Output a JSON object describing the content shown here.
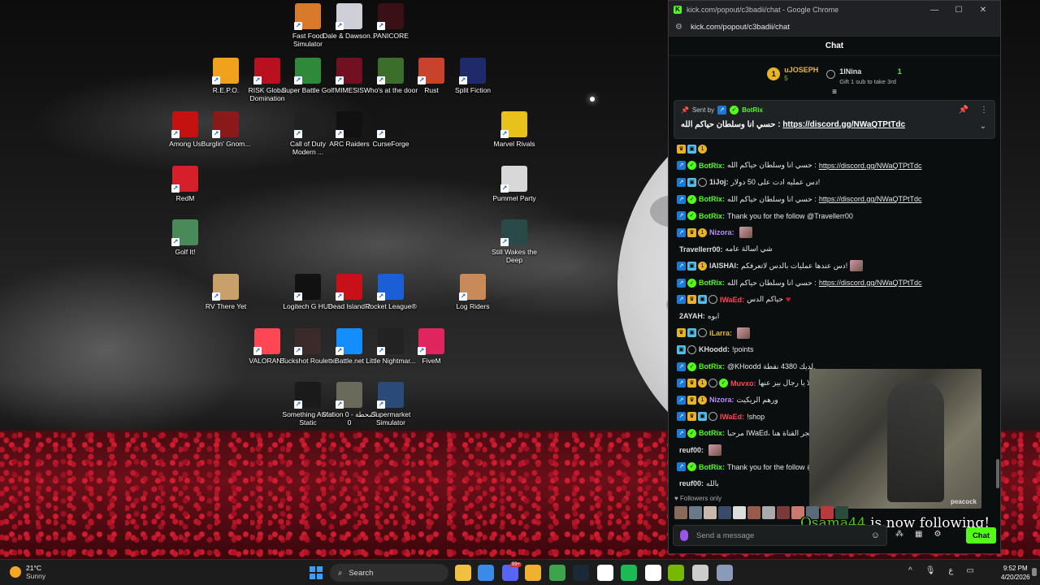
{
  "desktop_icons": [
    {
      "label": "Fast Food Simulator",
      "icon": "fastfood-app-icon",
      "color": "#d97a2a"
    },
    {
      "label": "Dale & Dawson...",
      "icon": "printer-app-icon",
      "color": "#cfcfd8"
    },
    {
      "label": "PANICORE",
      "icon": "panicore-app-icon",
      "color": "#3a1016"
    },
    {
      "label": "R.E.P.O.",
      "icon": "repo-app-icon",
      "color": "#f0a31a"
    },
    {
      "label": "RISK Global Domination",
      "icon": "risk-app-icon",
      "color": "#b8101e"
    },
    {
      "label": "Super Battle Golf",
      "icon": "golf-app-icon",
      "color": "#2e8a3a"
    },
    {
      "label": "MIMESIS",
      "icon": "mimesis-app-icon",
      "color": "#701020"
    },
    {
      "label": "Who's at the door",
      "icon": "door-app-icon",
      "color": "#3a6e2a"
    },
    {
      "label": "Rust",
      "icon": "rust-app-icon",
      "color": "#c9422b"
    },
    {
      "label": "Split Fiction",
      "icon": "splitfiction-app-icon",
      "color": "#1e2a6a"
    },
    {
      "label": "Among Us",
      "icon": "amongus-app-icon",
      "color": "#c51111"
    },
    {
      "label": "Burglin' Gnom...",
      "icon": "gnome-app-icon",
      "color": "#8a1a1a"
    },
    {
      "label": "Call of Duty Modern ...",
      "icon": "cod-app-icon",
      "color": "#202020"
    },
    {
      "label": "ARC Raiders",
      "icon": "arcraiders-app-icon",
      "color": "#111111"
    },
    {
      "label": "CurseForge",
      "icon": "curseforge-app-icon",
      "color": "#151515"
    },
    {
      "label": "Marvel Rivals",
      "icon": "marvelrivals-app-icon",
      "color": "#e8c21a"
    },
    {
      "label": "RedM",
      "icon": "redm-app-icon",
      "color": "#d51f2a"
    },
    {
      "label": "Pummel Party",
      "icon": "pummelparty-app-icon",
      "color": "#d8d8d8"
    },
    {
      "label": "Golf It!",
      "icon": "golfit-app-icon",
      "color": "#4a8a5a"
    },
    {
      "label": "Still Wakes the Deep",
      "icon": "stillwakes-app-icon",
      "color": "#2a4a4a"
    },
    {
      "label": "RV There Yet",
      "icon": "rvthereyet-app-icon",
      "color": "#c9a06a"
    },
    {
      "label": "Logitech G HUB",
      "icon": "logitech-app-icon",
      "color": "#111111"
    },
    {
      "label": "Dead Island 2",
      "icon": "deadisland-app-icon",
      "color": "#c81018"
    },
    {
      "label": "Rocket League®",
      "icon": "rocketleague-app-icon",
      "color": "#1b5fd6"
    },
    {
      "label": "Log Riders",
      "icon": "logriders-app-icon",
      "color": "#c98a5a"
    },
    {
      "label": "VALORANT",
      "icon": "valorant-app-icon",
      "color": "#ff4655"
    },
    {
      "label": "Buckshot Roulette",
      "icon": "buckshot-app-icon",
      "color": "#3a2a2a"
    },
    {
      "label": "Battle.net",
      "icon": "battlenet-app-icon",
      "color": "#148eff"
    },
    {
      "label": "Little Nightmar...",
      "icon": "littlenightmares-app-icon",
      "color": "#222222"
    },
    {
      "label": "FiveM",
      "icon": "fivem-app-icon",
      "color": "#e0245e"
    },
    {
      "label": "Something Awful Static",
      "icon": "awfulstatic-app-icon",
      "color": "#1a1a1a"
    },
    {
      "label": "Station 0 - المحطة 0",
      "icon": "station0-app-icon",
      "color": "#6a6a5a"
    },
    {
      "label": "Supermarket Simulator",
      "icon": "supermarket-app-icon",
      "color": "#2a4a7a"
    }
  ],
  "browser": {
    "title": "kick.com/popout/c3badii/chat - Google Chrome",
    "url": "kick.com/popout/c3badii/chat",
    "minimize": "—",
    "maximize": "☐",
    "close": "✕"
  },
  "chat": {
    "header": "Chat",
    "leaderboard": {
      "rank": "1",
      "top_user": "uJOSEPH",
      "top_count": "5",
      "gift_user": "1lNina",
      "gift_count": "1",
      "gift_text": "Gift 1 sub to take 3rd"
    },
    "pinned": {
      "sent_by_label": "Sent by",
      "sender": "BotRix",
      "text": "حسي انا وسلطان حياكم الله :",
      "link": "https://discord.gg/NWaQTPtTdc"
    },
    "messages": [
      {
        "user": "",
        "user_color": "#e7b93a",
        "badges": [
          "crown",
          "sub",
          "gift"
        ],
        "text": ""
      },
      {
        "user": "BotRix:",
        "user_color": "#53fc18",
        "badges": [
          "bot",
          "ver"
        ],
        "text": "حسي انا وسلطان حياكم الله :",
        "link": "https://discord.gg/NWaQTPtTdc"
      },
      {
        "user": "1iJoj:",
        "user_color": "#dddddd",
        "badges": [
          "bot",
          "sub",
          "ring"
        ],
        "text": "دس عمليه ادت على 50 دولار!"
      },
      {
        "user": "BotRix:",
        "user_color": "#53fc18",
        "badges": [
          "bot",
          "ver"
        ],
        "text": "حسي انا وسلطان حياكم الله :",
        "link": "https://discord.gg/NWaQTPtTdc"
      },
      {
        "user": "BotRix:",
        "user_color": "#53fc18",
        "badges": [
          "bot",
          "ver"
        ],
        "text": "Thank you for the follow @Travellerr00"
      },
      {
        "user": "Nizora:",
        "user_color": "#b88cff",
        "badges": [
          "bot",
          "crown",
          "gift"
        ],
        "text": "",
        "emote": true
      },
      {
        "user": "Travellerr00:",
        "user_color": "#dddddd",
        "badges": [],
        "text": "شي اسالة عامه"
      },
      {
        "user": "lAISHAl:",
        "user_color": "#dddddd",
        "badges": [
          "bot",
          "sub",
          "gift"
        ],
        "text": "دس عندها عمليات بالدس لاتعرفكم!",
        "emote": true
      },
      {
        "user": "BotRix:",
        "user_color": "#53fc18",
        "badges": [
          "bot",
          "ver"
        ],
        "text": "حسي انا وسلطان حياكم الله :",
        "link": "https://discord.gg/NWaQTPtTdc"
      },
      {
        "user": "IWaEd:",
        "user_color": "#ff4655",
        "badges": [
          "bot",
          "crown",
          "sub",
          "ring"
        ],
        "text": "حياكم الدس",
        "heart": true
      },
      {
        "user": "2AYAH:",
        "user_color": "#dddddd",
        "badges": [],
        "text": "ابوه"
      },
      {
        "user": "iLarra:",
        "user_color": "#e7b93a",
        "badges": [
          "crown",
          "sub",
          "ring"
        ],
        "text": "",
        "emote": true
      },
      {
        "user": "KHoodd:",
        "user_color": "#dddddd",
        "badges": [
          "sub",
          "ring"
        ],
        "text": "!points"
      },
      {
        "user": "BotRix:",
        "user_color": "#53fc18",
        "badges": [
          "bot",
          "ver"
        ],
        "text": "@KHoodd لديك 4380 نقطة."
      },
      {
        "user": "Muvxo:",
        "user_color": "#ff4655",
        "badges": [
          "bot",
          "crown",
          "gift",
          "ring",
          "ver"
        ],
        "text": "تساعل الطب وانا احوله لا يا رجال بيز عنها"
      },
      {
        "user": "Nizora:",
        "user_color": "#b88cff",
        "badges": [
          "bot",
          "crown",
          "gift"
        ],
        "text": "ورهم الريكيت"
      },
      {
        "user": "IWaEd:",
        "user_color": "#ff4655",
        "badges": [
          "bot",
          "crown",
          "sub",
          "ring"
        ],
        "text": "!shop"
      },
      {
        "user": "BotRix:",
        "user_color": "#53fc18",
        "badges": [
          "bot",
          "ver"
        ],
        "text": "مرحبا IWaEd، متجر القناة هنا :",
        "link": "https://botrix.live/k/c3badii/shop"
      },
      {
        "user": "reuf00:",
        "user_color": "#dddddd",
        "badges": [],
        "text": "",
        "emote": true
      },
      {
        "user": "BotRix:",
        "user_color": "#53fc18",
        "badges": [
          "bot",
          "ver"
        ],
        "text": "Thank you for the follow @AS_707"
      },
      {
        "user": "reuf00:",
        "user_color": "#dddddd",
        "badges": [],
        "text": "بالله"
      }
    ],
    "followers_only": "Followers only",
    "input_placeholder": "Send a message",
    "send_label": "Chat",
    "video_watermark": "peacock",
    "alert": {
      "user": "Osama44",
      "text": " is now following!"
    }
  },
  "taskbar": {
    "weather_temp": "21°C",
    "weather_cond": "Sunny",
    "search_label": "Search",
    "time": "9:52 PM",
    "date": "4/20/2026",
    "lang": "ع",
    "tray_chevron": "^",
    "badge_count": "99+",
    "apps": [
      {
        "name": "file-explorer-icon",
        "color": "#f0c040"
      },
      {
        "name": "store-icon",
        "color": "#3a8ae8"
      },
      {
        "name": "discord-icon",
        "color": "#5865f2"
      },
      {
        "name": "chat-bubble-icon",
        "color": "#f0b030"
      },
      {
        "name": "chrome-icon",
        "color": "#3fa34d"
      },
      {
        "name": "steam-icon",
        "color": "#1b2838"
      },
      {
        "name": "settings-icon",
        "color": "#ffffff"
      },
      {
        "name": "spotify-icon",
        "color": "#1db954"
      },
      {
        "name": "openai-icon",
        "color": "#ffffff"
      },
      {
        "name": "nvidia-icon",
        "color": "#76b900"
      },
      {
        "name": "obs-icon",
        "color": "#cccccc"
      },
      {
        "name": "gear-app-icon",
        "color": "#8a9ab8"
      }
    ]
  }
}
